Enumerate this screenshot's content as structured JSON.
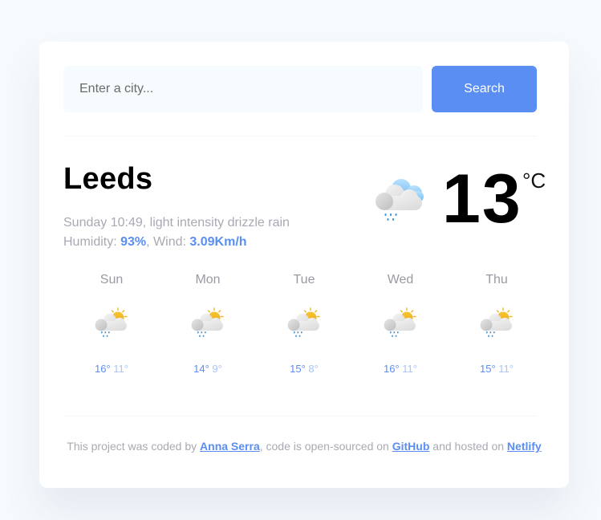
{
  "search": {
    "placeholder": "Enter a city...",
    "value": "",
    "button_label": "Search"
  },
  "current": {
    "city": "Leeds",
    "day_time": "Sunday 10:49",
    "description": "light intensity drizzle rain",
    "humidity_label": "Humidity: ",
    "humidity": "93%",
    "wind_label": "Wind: ",
    "wind": "3.09Km/h",
    "icon": "cloud-drizzle-icon",
    "temperature": "13",
    "unit": "°C"
  },
  "forecast": [
    {
      "day": "Sun",
      "icon": "sun-cloud-rain-icon",
      "max": "16°",
      "min": "11°"
    },
    {
      "day": "Mon",
      "icon": "sun-cloud-rain-icon",
      "max": "14°",
      "min": "9°"
    },
    {
      "day": "Tue",
      "icon": "sun-cloud-rain-icon",
      "max": "15°",
      "min": "8°"
    },
    {
      "day": "Wed",
      "icon": "sun-cloud-rain-icon",
      "max": "16°",
      "min": "11°"
    },
    {
      "day": "Thu",
      "icon": "sun-cloud-rain-icon",
      "max": "15°",
      "min": "11°"
    }
  ],
  "footer": {
    "text1": "This project was coded by ",
    "author": "Anna Serra",
    "text2": ", code is open-sourced on ",
    "github": "GitHub",
    "text3": " and hosted on ",
    "netlify": "Netlify"
  },
  "colors": {
    "accent": "#5a8ef2",
    "background": "#f6fafd",
    "card": "#ffffff",
    "muted_text": "#a9a9b4"
  }
}
